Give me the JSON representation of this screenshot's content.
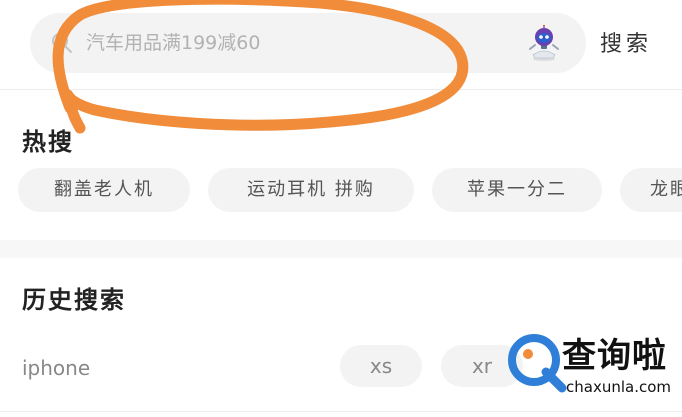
{
  "search": {
    "placeholder": "汽车用品满199减60",
    "button_label": "搜索"
  },
  "hot_search": {
    "title": "热搜",
    "items": [
      {
        "label": "翻盖老人机"
      },
      {
        "label": "运动耳机 拼购"
      },
      {
        "label": "苹果一分二"
      },
      {
        "label": "龙眼"
      }
    ]
  },
  "history": {
    "title": "历史搜索",
    "items": [
      {
        "label": "iphone"
      },
      {
        "label": "xs"
      },
      {
        "label": "xr"
      }
    ]
  },
  "watermark": {
    "text": "查询啦",
    "sub": "chaxunla.com"
  },
  "colors": {
    "accent_orange": "#f08c3a",
    "watermark_blue": "#2f7fd8"
  },
  "icons": {
    "search": "search-icon",
    "assistant": "robot-icon"
  }
}
